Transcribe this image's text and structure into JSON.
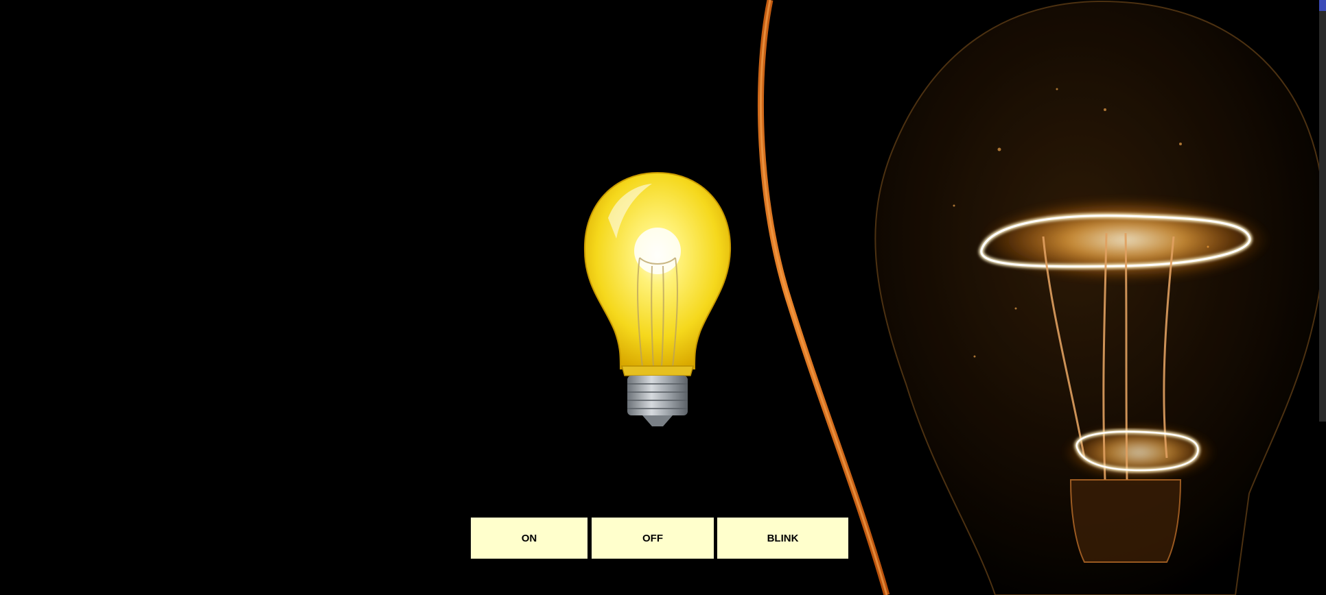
{
  "controls": {
    "on_label": "ON",
    "off_label": "OFF",
    "blink_label": "BLINK"
  },
  "bulb": {
    "state": "on",
    "glass_color": "#f5d81c",
    "base_color": "#9aa0a6"
  },
  "background": {
    "icon": "glowing-filament-bulb-photo",
    "color": "#000000",
    "glow_color": "#ffb347"
  }
}
